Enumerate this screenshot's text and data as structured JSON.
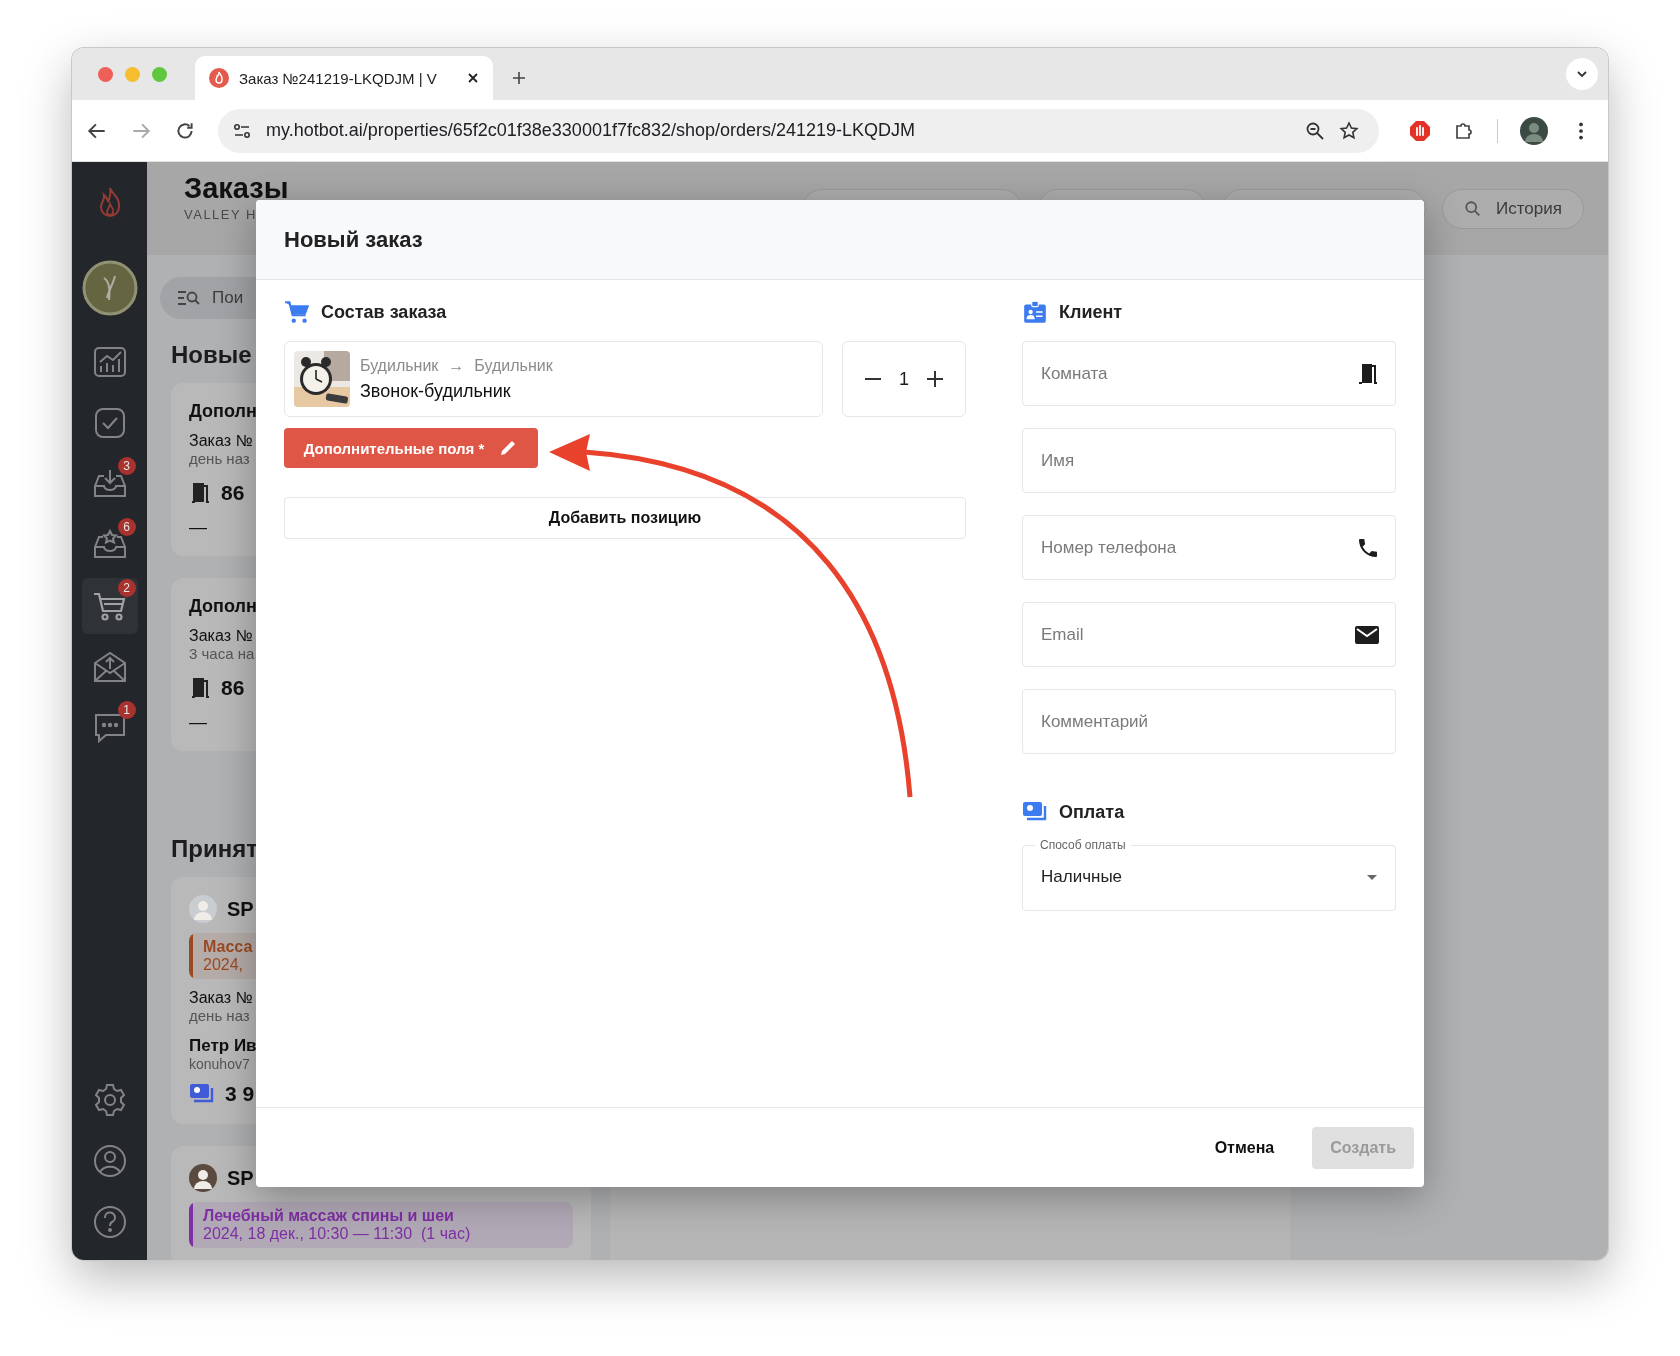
{
  "browser": {
    "tab": {
      "title": "Заказ №241219-LKQDJM | V",
      "selected": true
    },
    "url": "my.hotbot.ai/properties/65f2c01f38e330001f7fc832/shop/orders/241219-LKQDJM"
  },
  "sidebar": {
    "items": [
      {
        "kind": "chart",
        "selected": false
      },
      {
        "kind": "tasks",
        "selected": false
      },
      {
        "kind": "inbox",
        "badge": "3",
        "selected": false
      },
      {
        "kind": "reviews",
        "badge": "6",
        "selected": false
      },
      {
        "kind": "cart",
        "badge": "2",
        "selected": true
      },
      {
        "kind": "outbox",
        "selected": false
      },
      {
        "kind": "chat",
        "badge": "1",
        "selected": false
      }
    ],
    "bottom_items": [
      {
        "kind": "settings"
      },
      {
        "kind": "profile"
      },
      {
        "kind": "help"
      }
    ]
  },
  "page": {
    "title": "Заказы",
    "subtitle": "VALLEY H",
    "history_button": "История",
    "search_placeholder": "Пои",
    "new_section": {
      "title": "Новые",
      "cards": [
        {
          "title": "Дополн",
          "order": "Заказ №",
          "time": "день наз",
          "room": "86",
          "note": "—"
        },
        {
          "title": "Дополн",
          "order": "Заказ №",
          "time": "3 часа на",
          "room": "86",
          "note": "—"
        }
      ]
    },
    "accepted_section": {
      "title": "Принят",
      "cards": [
        {
          "name": "SP",
          "service": "Масса",
          "date": "2024,",
          "color": "#9a4a22",
          "order": "Заказ №",
          "time": "день наз",
          "customer": "Петр Ив",
          "email": "konuhov7",
          "price": "3 9"
        },
        {
          "name": "SP",
          "service": "Лечебный массаж спины и шеи",
          "date": "2024, 18 дек., 10:30 — 11:30  (1 час)",
          "color": "#7e2fa3"
        }
      ]
    }
  },
  "modal": {
    "title": "Новый заказ",
    "order_section": {
      "title": "Состав заказа",
      "items": [
        {
          "category": "Будильник",
          "arrow": "→",
          "subcategory": "Будильник",
          "name": "Звонок-будильник",
          "quantity": "1"
        }
      ],
      "extra_fields_button": "Дополнительные поля *",
      "add_button": "Добавить позицию"
    },
    "client_section": {
      "title": "Клиент",
      "fields": [
        {
          "placeholder": "Комната",
          "kind": "room"
        },
        {
          "placeholder": "Имя",
          "kind": "name"
        },
        {
          "placeholder": "Номер телефона",
          "kind": "phone"
        },
        {
          "placeholder": "Email",
          "kind": "email"
        },
        {
          "placeholder": "Комментарий",
          "kind": "comment"
        }
      ]
    },
    "payment_section": {
      "title": "Оплата",
      "select": {
        "label": "Способ оплаты",
        "value": "Наличные"
      }
    },
    "buttons": [
      {
        "label": "Отмена",
        "kind": "text",
        "disabled": false
      },
      {
        "label": "Создать",
        "kind": "primary",
        "disabled": true
      }
    ]
  }
}
